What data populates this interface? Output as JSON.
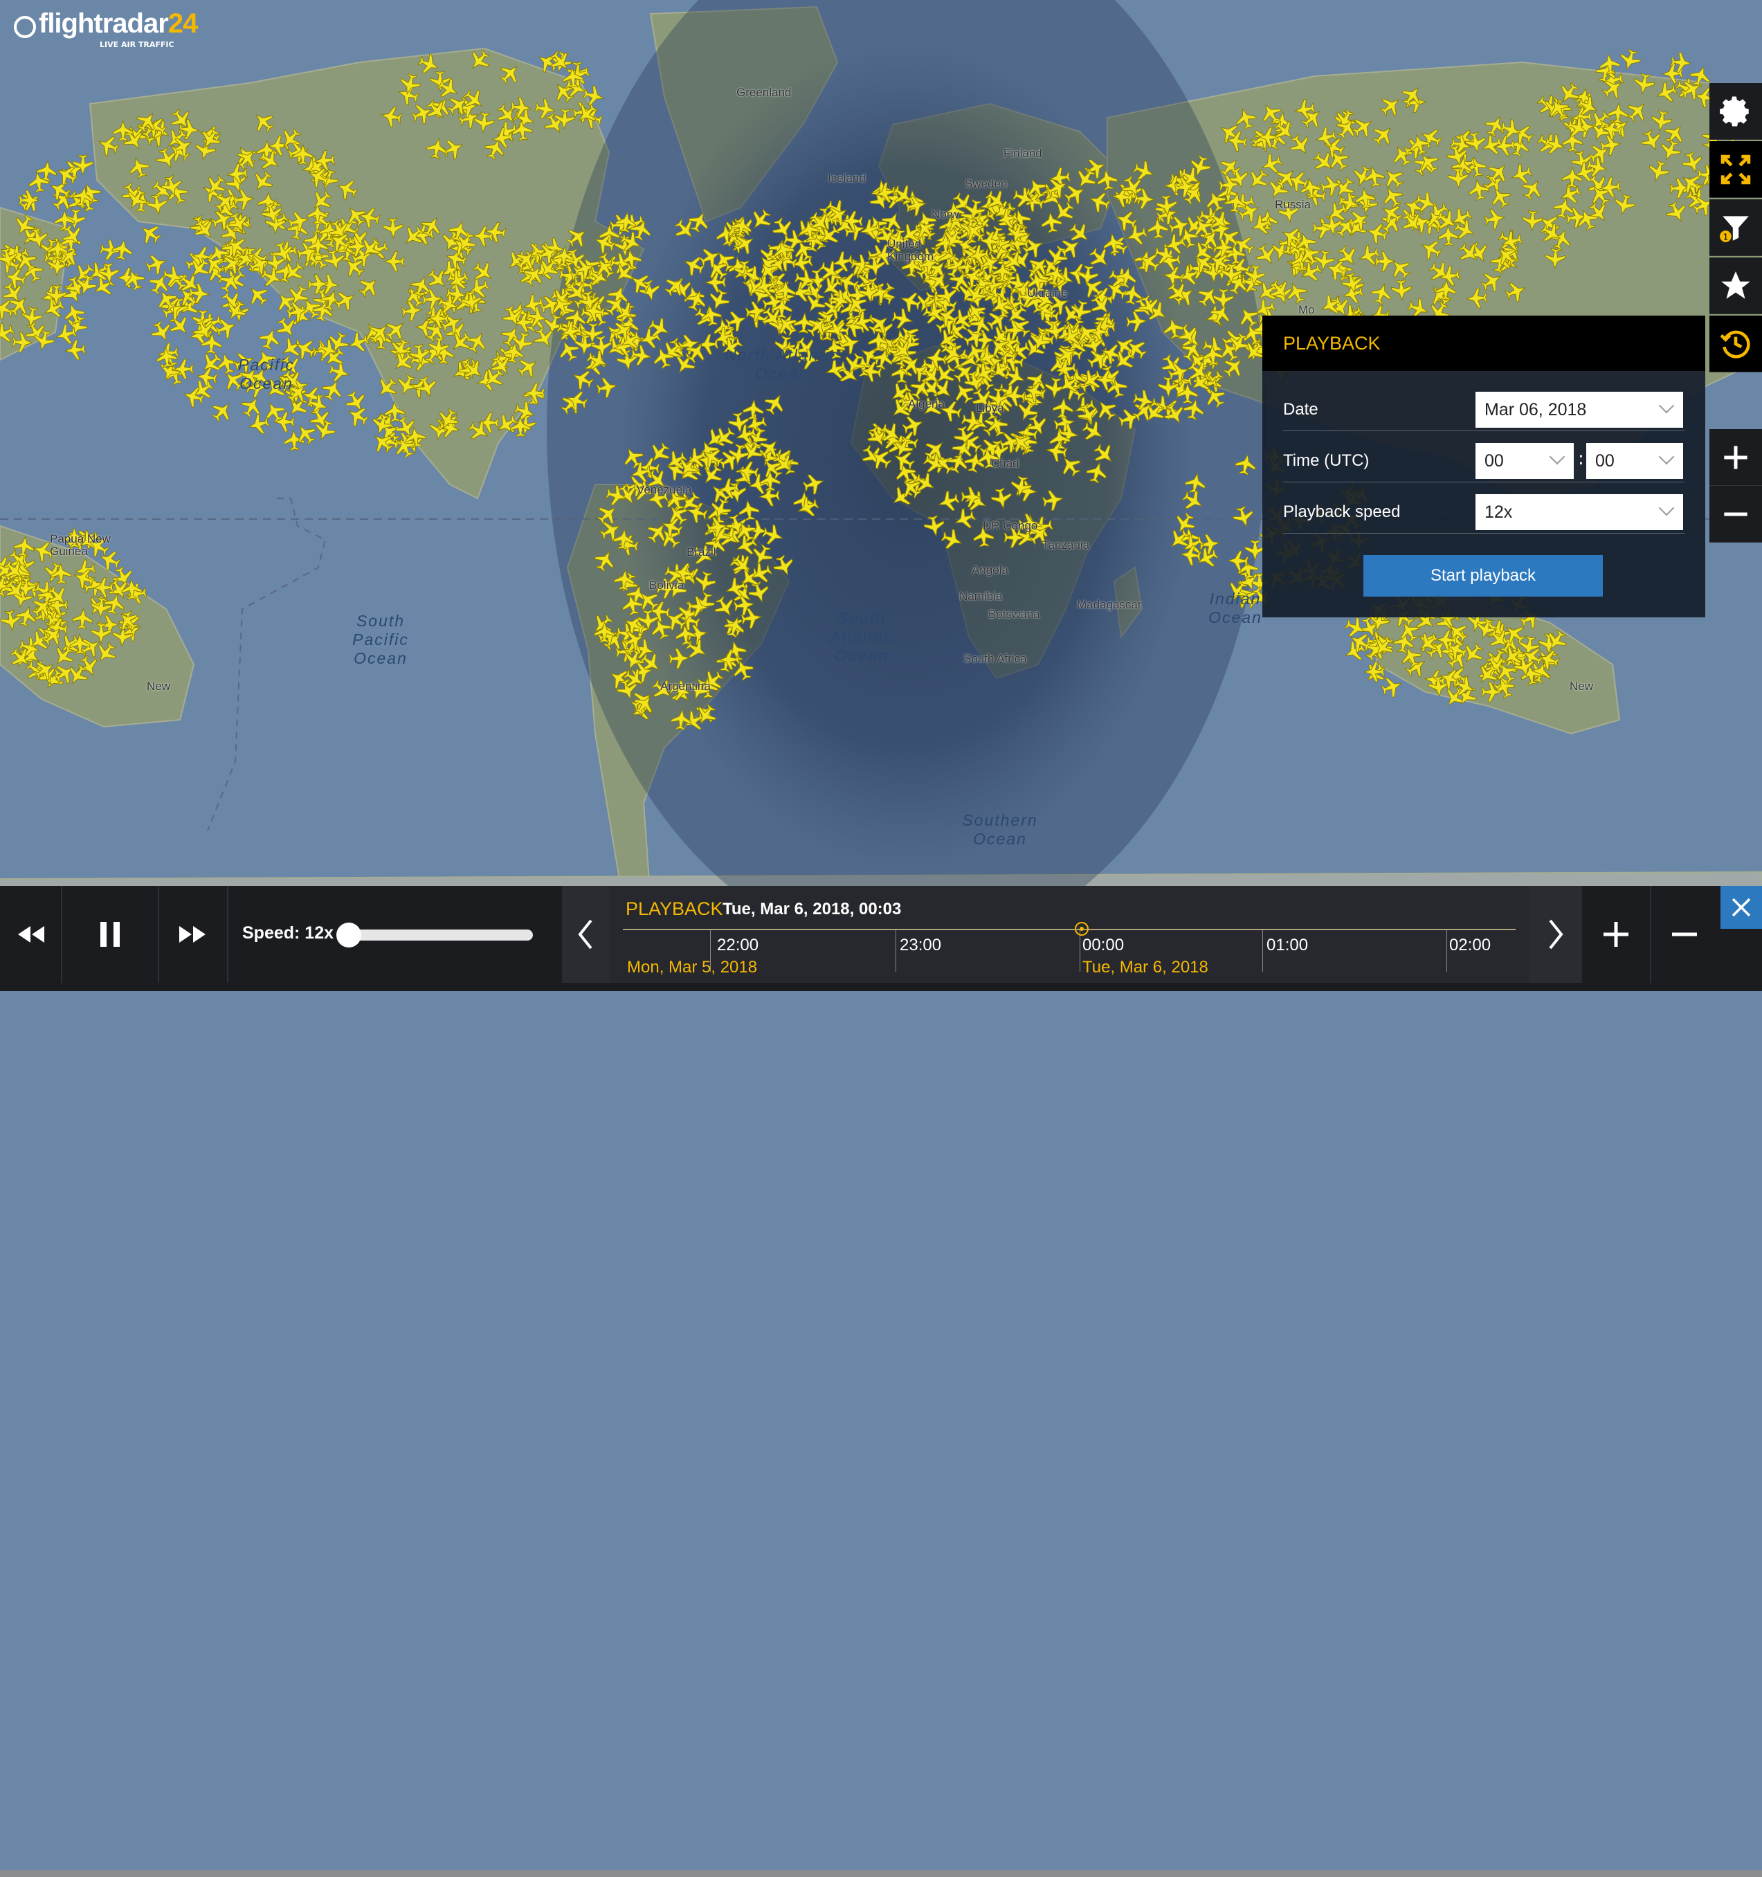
{
  "app": {
    "brand_main": "flightradar",
    "brand_num": "24",
    "tagline": "LIVE AIR TRAFFIC"
  },
  "map": {
    "place_labels": [
      "Greenland",
      "Iceland",
      "Finland",
      "Sweden",
      "Norw",
      "United Kingdom",
      "Russia",
      "Ukraine",
      "Algeria",
      "Libya",
      "Chad",
      "DR Congo",
      "Tanzania",
      "Angola",
      "Namibia",
      "Botswana",
      "South Africa",
      "Madagascar",
      "Brazil",
      "Bolivia",
      "Argentina",
      "Venezuela",
      "Papua New Guinea",
      "New",
      "Mo",
      "Somalia",
      "Niger"
    ],
    "ocean_labels": [
      "Pacific Ocean",
      "North Atlantic Ocean",
      "South Pacific Ocean",
      "South Atlantic Ocean",
      "Indian Ocean",
      "Southern Ocean"
    ],
    "colors": {
      "ocean": "#6b87a8",
      "land": "#8c9a7a",
      "night": "#1e2f4b",
      "aircraft": "#f2e41c"
    }
  },
  "toolbar": {
    "icons": [
      "gear-icon",
      "fullscreen-icon",
      "filter-icon",
      "star-icon",
      "playback-icon",
      "zoom-in-icon",
      "zoom-out-icon"
    ],
    "filter_badge": "1"
  },
  "playback_panel": {
    "title": "PLAYBACK",
    "date_label": "Date",
    "date_value": "Mar 06, 2018",
    "time_label": "Time (UTC)",
    "hour_value": "00",
    "time_separator": ":",
    "minute_value": "00",
    "speed_label": "Playback speed",
    "speed_value": "12x",
    "start_button": "Start playback"
  },
  "bottom_bar": {
    "speed_label": "Speed: 12x",
    "speed_slider_fraction": 0.0,
    "timeline": {
      "title": "PLAYBACK",
      "current": "Tue, Mar 6, 2018, 00:03",
      "ticks": [
        "22:00",
        "23:00",
        "00:00",
        "01:00",
        "02:00"
      ],
      "day_left": "Mon, Mar 5, 2018",
      "day_right": "Tue, Mar 6, 2018"
    }
  }
}
